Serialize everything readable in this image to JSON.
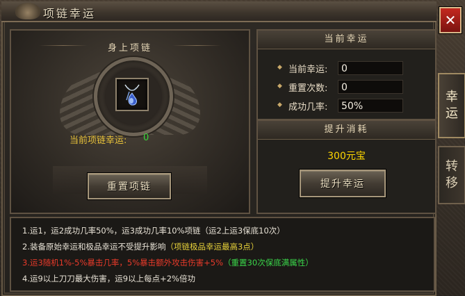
{
  "window": {
    "title": "项链幸运",
    "close_symbol": "✕"
  },
  "tabs": [
    {
      "label_line1": "幸",
      "label_line2": "运",
      "active": true
    },
    {
      "label_line1": "转",
      "label_line2": "移",
      "active": false
    }
  ],
  "left_panel": {
    "title": "身上项链",
    "necklace_icon": "sapphire-necklace-icon",
    "current_luck_label": "当前项链幸运:",
    "current_luck_value": "0",
    "reset_button": "重置项链"
  },
  "current_luck_panel": {
    "header": "当前幸运",
    "rows": [
      {
        "label": "当前幸运:",
        "value": "0"
      },
      {
        "label": "重置次数:",
        "value": "0"
      },
      {
        "label": "成功几率:",
        "value": "50%"
      }
    ]
  },
  "upgrade_cost_panel": {
    "header": "提升消耗",
    "cost": "300元宝",
    "upgrade_button": "提升幸运"
  },
  "notes": [
    [
      {
        "text": "1.运1，运2成功几率50%，运3成功几率10%项链（运2上运3保底10次）",
        "color": "white"
      }
    ],
    [
      {
        "text": "2.装备原始幸运和极品幸运不受提升影响",
        "color": "white"
      },
      {
        "text": "（项链极品幸运最高3点）",
        "color": "yellow"
      }
    ],
    [
      {
        "text": "3.运3随机1%-5%暴击几率，5%暴击额外攻击伤害+5%",
        "color": "red"
      },
      {
        "text": "（重置30次保底满属性）",
        "color": "green"
      }
    ],
    [
      {
        "text": "4.运9以上刀刀最大伤害，运9以上每点+2%倍功",
        "color": "white"
      }
    ]
  ],
  "colors": {
    "gold": "#ffd700",
    "luck_green": "#3ad63a",
    "warn_red": "#e83a2a",
    "label_yellow": "#e8c23a",
    "close_red": "#c4281f"
  }
}
